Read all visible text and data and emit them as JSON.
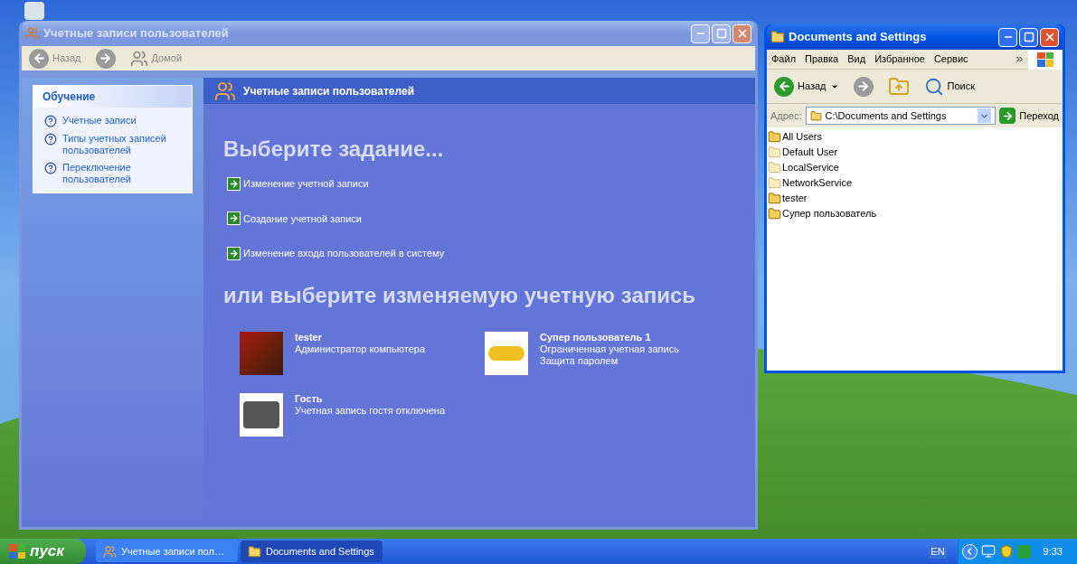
{
  "accounts_window": {
    "title": "Учетные записи пользователей",
    "active": false,
    "toolbar": [
      {
        "kind": "back",
        "label": "Назад",
        "disabled": true
      },
      {
        "kind": "forward",
        "disabled": true
      },
      {
        "kind": "home",
        "label": "Домой",
        "disabled": true
      }
    ],
    "sidebar": {
      "title": "Обучение",
      "items": [
        "Учетные записи",
        "Типы учетных записей пользователей",
        "Переключение пользователей"
      ]
    },
    "header": "Учетные записи пользователей",
    "heading": "Выберите задание...",
    "tasks": [
      "Изменение учетной записи",
      "Создание учетной записи",
      "Изменение входа пользователей в систему"
    ],
    "heading_2": "или выберите изменяемую учетную запись",
    "accounts": [
      {
        "name": "tester",
        "lines": [
          "Администратор компьютера"
        ],
        "kind": "chess"
      },
      {
        "name": "Супер пользователь 1",
        "lines": [
          "Ограниченная учетная запись",
          "Защита паролем"
        ],
        "kind": "car"
      },
      {
        "name": "Гость",
        "lines": [
          "Учетная запись гостя отключена"
        ],
        "kind": "suitcase"
      }
    ]
  },
  "explorer_window": {
    "title": "Documents and Settings",
    "active": true,
    "menu": [
      "Файл",
      "Правка",
      "Вид",
      "Избранное",
      "Сервис"
    ],
    "toolbar": [
      {
        "kind": "back",
        "label": "Назад",
        "disabled": false
      },
      {
        "kind": "forward",
        "disabled": true
      },
      {
        "kind": "up",
        "disabled": false
      },
      {
        "kind": "search",
        "label": "Поиск",
        "disabled": false
      }
    ],
    "address": {
      "label": "Адрес:",
      "value": "C:\\Documents and Settings",
      "go": "Переход"
    },
    "items": [
      {
        "name": "All Users",
        "hidden": false
      },
      {
        "name": "Default User",
        "hidden": true
      },
      {
        "name": "LocalService",
        "hidden": true
      },
      {
        "name": "NetworkService",
        "hidden": true
      },
      {
        "name": "tester",
        "hidden": false
      },
      {
        "name": "Супер пользователь",
        "hidden": false
      }
    ]
  },
  "taskbar": {
    "start": "пуск",
    "tasks": [
      {
        "label": "Учетные записи пол…",
        "selected": false
      },
      {
        "label": "Documents and Settings",
        "selected": true
      }
    ],
    "language": "EN",
    "clock": "9:33"
  }
}
